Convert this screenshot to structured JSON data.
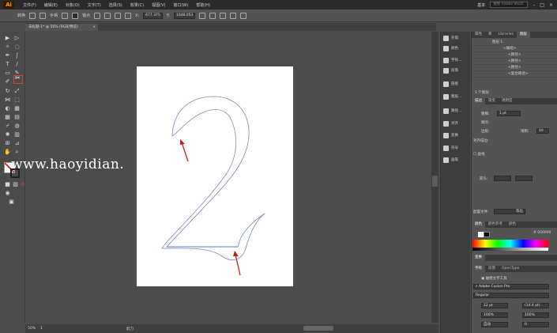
{
  "app": {
    "logo": "Ai"
  },
  "menu": [
    "文件(F)",
    "编辑(E)",
    "对象(O)",
    "文字(T)",
    "选择(S)",
    "效果(C)",
    "视图(V)",
    "窗口(W)",
    "帮助(H)"
  ],
  "window": {
    "workspace": "基本",
    "search_placeholder": "搜索 Adobe Stock"
  },
  "control_bar": {
    "anchor_label": "转换",
    "handle_label": "手柄",
    "anchor_points_label": "锚点",
    "x_value": "677.375",
    "y_value": "1048.053"
  },
  "document": {
    "tab_title": "未标题-1* @ 50% (RGB/预览)",
    "close": "×"
  },
  "watermark": "www.haoyidian.",
  "status": {
    "zoom": "50%",
    "artboard": "1",
    "tool": "剪刀"
  },
  "dock": [
    "外观",
    "颜色",
    "字符...",
    "段落",
    "链接",
    "图层...",
    "路径...",
    "对齐",
    "变换",
    "符号",
    "画笔"
  ],
  "layers_panel": {
    "tabs": [
      "属性",
      "库",
      "Libraries",
      "图层"
    ],
    "active_tab": "图层",
    "rows": [
      "图层 1",
      "<编组>",
      "<路径>",
      "<路径>",
      "<路径>",
      "<复合路径>"
    ],
    "footer": "1 个图层"
  },
  "stroke_panel": {
    "tabs": [
      "描边",
      "渐变",
      "透明度"
    ],
    "weight_label": "粗细:",
    "weight_value": "1 pt",
    "cap_label": "端点:",
    "corner_label": "边角:",
    "limit_label": "限制:",
    "limit_value": "10",
    "align_label": "对齐描边:",
    "dashed_label": "虚线",
    "arrow_label": "箭头:",
    "profile_label": "配置文件:",
    "profile_value": "等比"
  },
  "color_panel": {
    "tabs": [
      "颜色",
      "颜色参考",
      "颜色"
    ],
    "hex": "000000"
  },
  "transform_tab": "变换",
  "character_panel": {
    "tabs": [
      "字符",
      "段落",
      "OpenType"
    ],
    "touch_label": "触摸文字工具",
    "font": "Adobe Caslon Pro",
    "style": "Regular",
    "size": "12 pt",
    "leading": "(14.4 pt)",
    "hscale": "100%",
    "vscale": "100%",
    "kerning": "自动",
    "tracking": "0"
  }
}
